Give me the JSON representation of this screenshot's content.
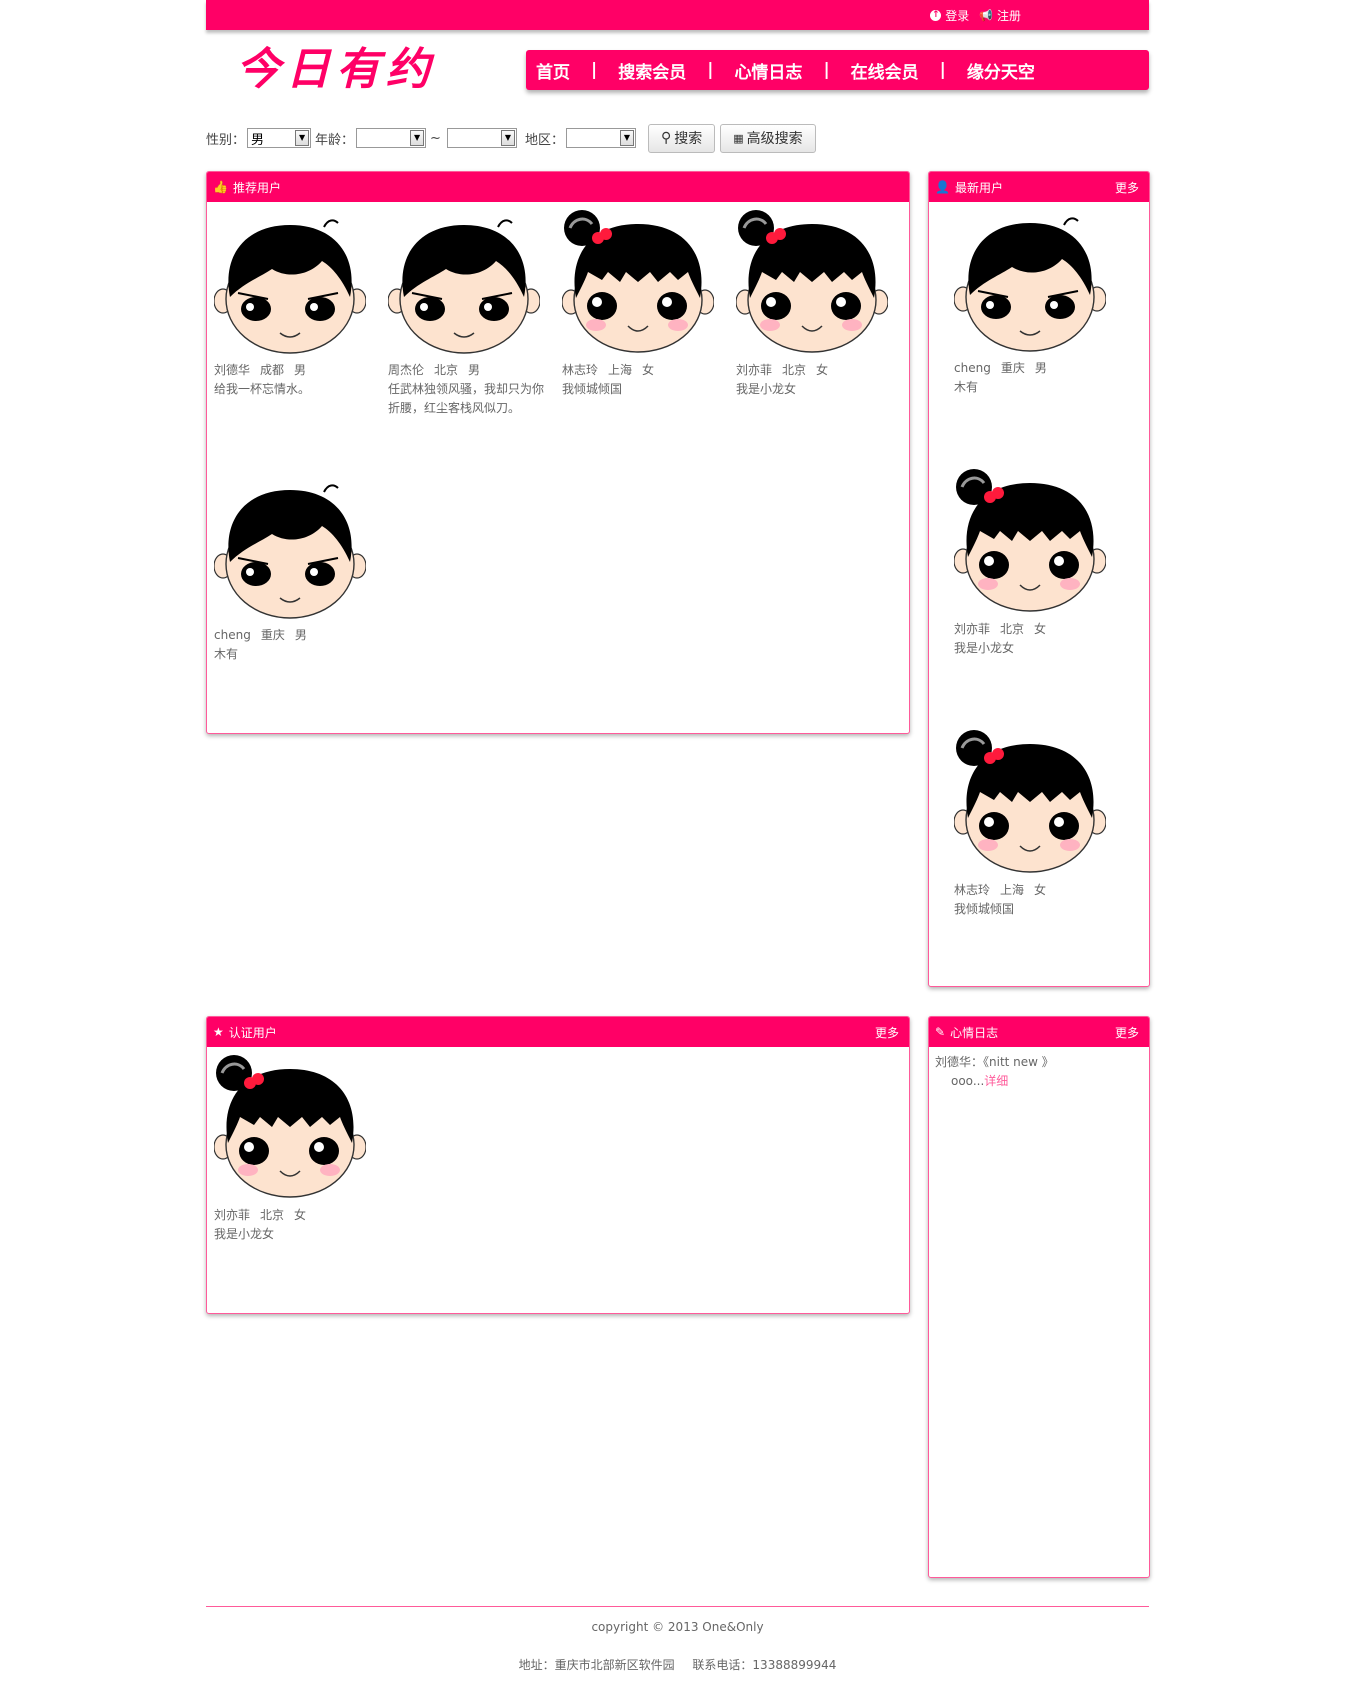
{
  "topbar": {
    "login": "登录",
    "register": "注册"
  },
  "logo": {
    "text": "今日有约"
  },
  "nav": {
    "items": [
      "首页",
      "搜索会员",
      "心情日志",
      "在线会员",
      "缘分天空"
    ],
    "separator": "|"
  },
  "search": {
    "gender_label": "性别：",
    "gender_value": "男",
    "age_label": "年龄：",
    "age_sep": "~",
    "region_label": "地区：",
    "search_button": "搜索",
    "advanced_button": "高级搜索"
  },
  "recommended": {
    "title": "推荐用户",
    "users": [
      {
        "name": "刘德华",
        "city": "成都",
        "gender": "男",
        "desc": "给我一杯忘情水。",
        "avatar": "boy"
      },
      {
        "name": "周杰伦",
        "city": "北京",
        "gender": "男",
        "desc": "任武林独领风骚，我却只为你折腰，红尘客栈风似刀。",
        "avatar": "boy"
      },
      {
        "name": "林志玲",
        "city": "上海",
        "gender": "女",
        "desc": "我倾城倾国",
        "avatar": "girl"
      },
      {
        "name": "刘亦菲",
        "city": "北京",
        "gender": "女",
        "desc": "我是小龙女",
        "avatar": "girl"
      },
      {
        "name": "cheng",
        "city": "重庆",
        "gender": "男",
        "desc": "木有",
        "avatar": "boy"
      }
    ]
  },
  "newest": {
    "title": "最新用户",
    "more": "更多",
    "users": [
      {
        "name": "cheng",
        "city": "重庆",
        "gender": "男",
        "desc": "木有",
        "avatar": "boy"
      },
      {
        "name": "刘亦菲",
        "city": "北京",
        "gender": "女",
        "desc": "我是小龙女",
        "avatar": "girl"
      },
      {
        "name": "林志玲",
        "city": "上海",
        "gender": "女",
        "desc": "我倾城倾国",
        "avatar": "girl"
      }
    ]
  },
  "verified": {
    "title": "认证用户",
    "more": "更多",
    "users": [
      {
        "name": "刘亦菲",
        "city": "北京",
        "gender": "女",
        "desc": "我是小龙女",
        "avatar": "girl"
      }
    ]
  },
  "diary": {
    "title": "心情日志",
    "more": "更多",
    "author": "刘德华：",
    "entry_title": "《nitt new 》",
    "excerpt": "ooo...",
    "detail": "详细"
  },
  "footer": {
    "copyright": "copyright © 2013 One&Only",
    "address": "地址：重庆市北部新区软件园",
    "phone": "联系电话：13388899944"
  },
  "colors": {
    "brand": "#ff0066",
    "border": "#ff5a9a"
  }
}
